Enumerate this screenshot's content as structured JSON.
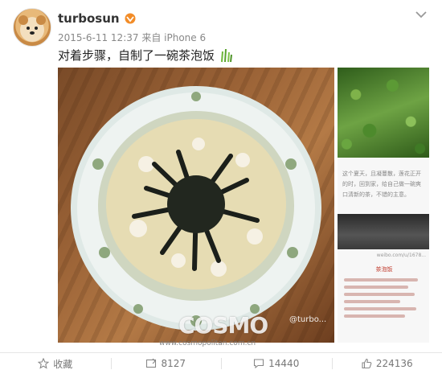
{
  "post": {
    "username": "turbosun",
    "date": "2015-6-11 12:37",
    "source": "来自 iPhone 6",
    "text": "对着步骤，自制了一碗茶泡饭"
  },
  "watermark": {
    "brand": "COSMO",
    "url": "www.cosmopolitan.com.cn",
    "handle": "@turbo..."
  },
  "side_article": {
    "paragraph": "这个夏天，且凝蔓散，莲花正开的时，回到家，给自己做一碗爽口清新的茶，不错的主意。",
    "caption": "weibo.com/u/1678...",
    "steps_title": "茶泡饭"
  },
  "actions": {
    "favorite_label": "收藏",
    "repost_count": "8127",
    "comment_count": "14440",
    "like_count": "224136"
  },
  "colors": {
    "accent_orange": "#f28c28",
    "text_gray": "#888888"
  },
  "icons": [
    "vip-badge-icon",
    "chevron-down-icon",
    "grass-emoji-icon",
    "star-icon",
    "repost-icon",
    "comment-icon",
    "like-icon"
  ]
}
